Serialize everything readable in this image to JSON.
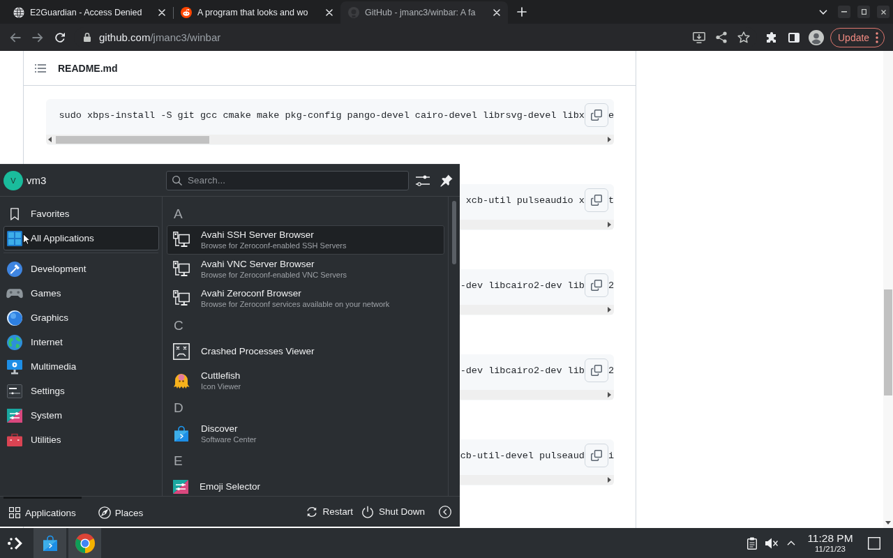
{
  "browser": {
    "tabs": [
      {
        "title": "E2Guardian - Access Denied",
        "selected": false
      },
      {
        "title": "A program that looks and wo",
        "selected": false
      },
      {
        "title": "GitHub - jmanc3/winbar: A fa",
        "selected": true
      }
    ],
    "back": {
      "disabled": true
    },
    "forward": {
      "disabled": true
    },
    "address": {
      "host": "github.com",
      "path": "/jmanc3/winbar"
    },
    "update_button": "Update"
  },
  "readme": {
    "title": "README.md",
    "code_blocks": [
      {
        "kind": "full",
        "text": "sudo xbps-install -S git gcc cmake make pkg-config pango-devel cairo-devel librsvg-devel libx",
        "tail": "e"
      },
      {
        "kind": "clipped",
        "text": "xcb-util pulseaudio x",
        "tail": "t"
      },
      {
        "kind": "clipped",
        "text": "-dev libcairo2-dev lib",
        "tail": "2"
      },
      {
        "kind": "clipped",
        "text": "-dev libcairo2-dev lib",
        "tail": "2"
      },
      {
        "kind": "clipped",
        "text": "cb-util-devel pulseaud",
        "tail": "i"
      }
    ]
  },
  "launcher": {
    "user": {
      "initial": "V",
      "name": "vm3"
    },
    "search": {
      "placeholder": "Search..."
    },
    "views": [
      {
        "label": "Favorites",
        "selected": false
      },
      {
        "label": "All Applications",
        "selected": true
      }
    ],
    "categories": [
      {
        "label": "Development",
        "selected": false
      },
      {
        "label": "Games",
        "selected": false
      },
      {
        "label": "Graphics",
        "selected": false
      },
      {
        "label": "Internet",
        "selected": false
      },
      {
        "label": "Multimedia",
        "selected": false
      },
      {
        "label": "Settings",
        "selected": false
      },
      {
        "label": "System",
        "selected": false
      },
      {
        "label": "Utilities",
        "selected": false
      }
    ],
    "sections": [
      {
        "letter": "A",
        "apps": [
          {
            "name": "Avahi SSH Server Browser",
            "description": "Browse for Zeroconf-enabled SSH Servers",
            "selected": true
          },
          {
            "name": "Avahi VNC Server Browser",
            "description": "Browse for Zeroconf-enabled VNC Servers",
            "selected": false
          },
          {
            "name": "Avahi Zeroconf Browser",
            "description": "Browse for Zeroconf services available on your network",
            "selected": false
          }
        ]
      },
      {
        "letter": "C",
        "apps": [
          {
            "name": "Crashed Processes Viewer",
            "selected": false
          },
          {
            "name": "Cuttlefish",
            "description": "Icon Viewer",
            "selected": false
          }
        ]
      },
      {
        "letter": "D",
        "apps": [
          {
            "name": "Discover",
            "description": "Software Center",
            "selected": false
          }
        ]
      },
      {
        "letter": "E",
        "apps": [
          {
            "name": "Emoji Selector",
            "selected": false
          }
        ]
      }
    ],
    "bottom_tabs": [
      {
        "label": "Applications",
        "selected": true
      },
      {
        "label": "Places",
        "selected": false
      }
    ],
    "power_actions": [
      "Restart",
      "Shut Down"
    ]
  },
  "taskbar": {
    "tasks": [
      {
        "active": true
      },
      {
        "active": true
      }
    ],
    "clock": {
      "time": "11:28 PM",
      "date": "11/21/23"
    }
  }
}
